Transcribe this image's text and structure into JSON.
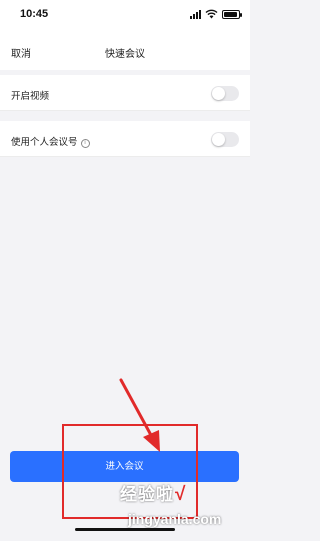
{
  "status_bar": {
    "time": "10:45",
    "signal_icon": "cellular-signal-icon",
    "wifi_icon": "wifi-icon",
    "battery_icon": "battery-icon",
    "battery_level": 0.9
  },
  "nav": {
    "cancel_label": "取消",
    "title": "快速会议"
  },
  "settings": [
    {
      "label": "开启视频",
      "enabled": false
    },
    {
      "label": "使用个人会议号",
      "enabled": false,
      "info_icon": "info-icon",
      "info_glyph": "i"
    }
  ],
  "primary_action": {
    "label": "进入会议"
  },
  "annotation": {
    "arrow_icon": "red-arrow-icon",
    "box": "red-highlight-box",
    "color": "#e12a2a"
  },
  "watermark": {
    "text": "经验啦",
    "check": "√",
    "url": "jingyanla.com"
  },
  "colors": {
    "accent": "#2a70ff",
    "background": "#f3f3f6",
    "annotation_red": "#e12a2a"
  }
}
